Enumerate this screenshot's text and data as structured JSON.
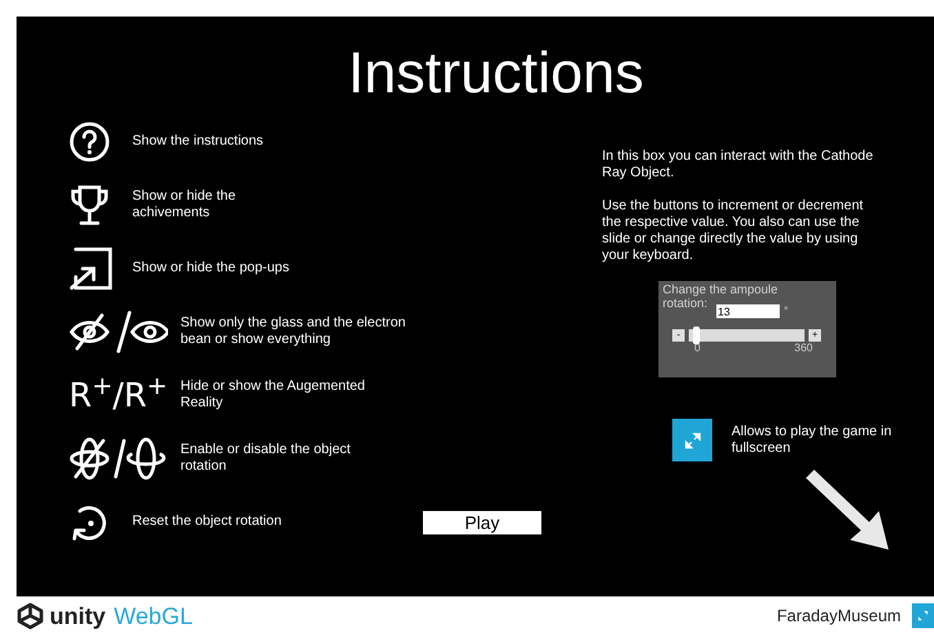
{
  "title": "Instructions",
  "instructions": [
    {
      "kind": "question",
      "text": "Show the instructions"
    },
    {
      "kind": "trophy",
      "text": "Show or hide the achivements"
    },
    {
      "kind": "popup",
      "text": "Show or hide the pop-ups"
    },
    {
      "kind": "eye_toggle",
      "text": "Show only the glass and the electron bean or show everything"
    },
    {
      "kind": "ar_toggle",
      "symbol": "R$^{+}$/R$^{+}$",
      "text": "Hide or show the Augemented Reality"
    },
    {
      "kind": "rotation_toggle",
      "text": "Enable or disable the object rotation"
    },
    {
      "kind": "reset",
      "text": "Reset the object rotation"
    }
  ],
  "play_button": "Play",
  "info": [
    "In this box you can interact with the Cathode Ray Object.",
    "Use the buttons to increment or decrement the respective value. You also can use the slide or change directly the value by using your keyboard."
  ],
  "rotation_panel": {
    "label": "Change the ampoule rotation:",
    "value": "13",
    "unit": "°",
    "decrement": "-",
    "increment": "+",
    "min": "0",
    "max": "360",
    "level": 0.036
  },
  "fullscreen_hint": "Allows to play the game in fullscreen",
  "footer": {
    "logo": "unity",
    "logo_suffix": "WebGL",
    "title": "FaradayMuseum"
  }
}
